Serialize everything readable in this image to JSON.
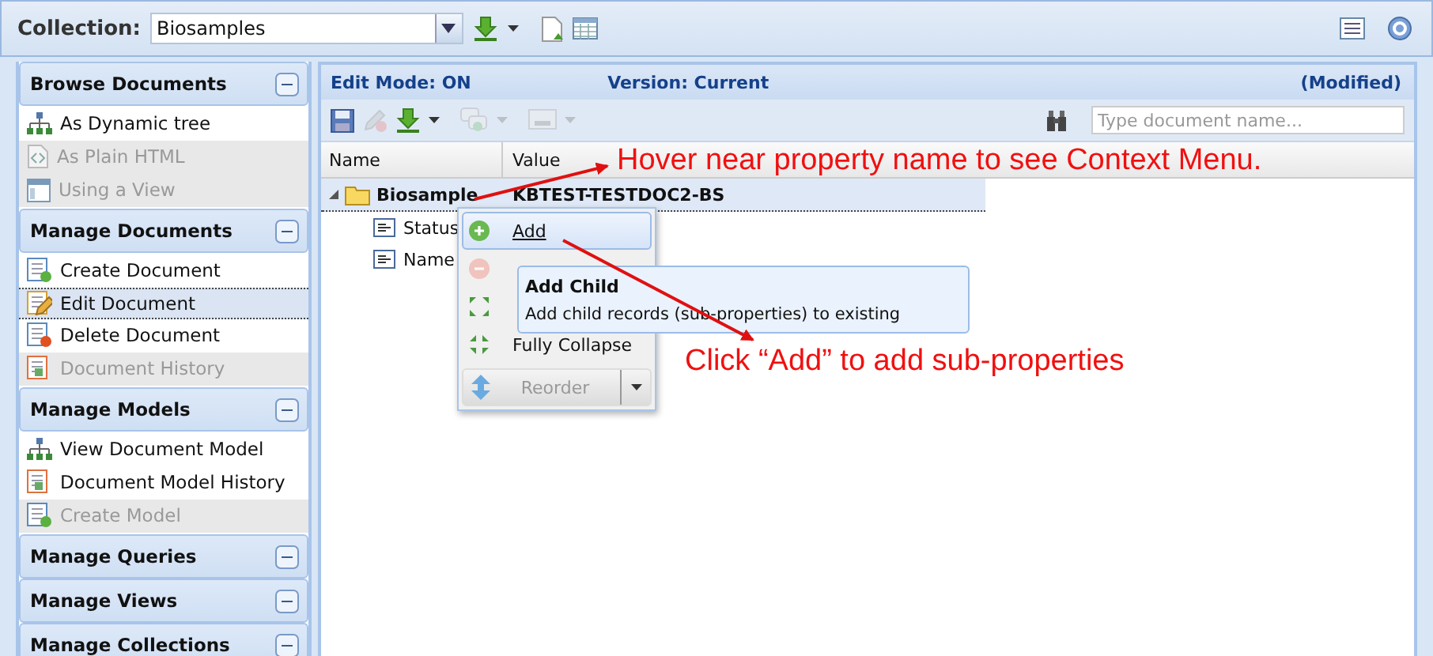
{
  "collection": {
    "label": "Collection:",
    "value": "Biosamples"
  },
  "sidebar": [
    {
      "title": "Browse Documents",
      "items": [
        {
          "label": "As Dynamic tree",
          "kind": "tree",
          "disabled": false,
          "selected": false
        },
        {
          "label": "As Plain HTML",
          "kind": "html",
          "disabled": true,
          "selected": false
        },
        {
          "label": "Using a View",
          "kind": "view",
          "disabled": true,
          "selected": false
        }
      ]
    },
    {
      "title": "Manage Documents",
      "items": [
        {
          "label": "Create Document",
          "kind": "create",
          "disabled": false,
          "selected": false
        },
        {
          "label": "Edit Document",
          "kind": "edit",
          "disabled": false,
          "selected": true
        },
        {
          "label": "Delete Document",
          "kind": "delete",
          "disabled": false,
          "selected": false
        },
        {
          "label": "Document History",
          "kind": "history",
          "disabled": true,
          "selected": false
        }
      ]
    },
    {
      "title": "Manage Models",
      "items": [
        {
          "label": "View Document Model",
          "kind": "tree",
          "disabled": false,
          "selected": false
        },
        {
          "label": "Document Model History",
          "kind": "history",
          "disabled": false,
          "selected": false
        },
        {
          "label": "Create Model",
          "kind": "create",
          "disabled": true,
          "selected": false
        }
      ]
    },
    {
      "title": "Manage Queries"
    },
    {
      "title": "Manage Views"
    },
    {
      "title": "Manage Collections"
    }
  ],
  "panel": {
    "edit_mode": "Edit Mode: ON",
    "version": "Version: Current",
    "status": "(Modified)"
  },
  "search": {
    "placeholder": "Type document name..."
  },
  "columns": [
    "Name",
    "Value"
  ],
  "tree": [
    {
      "name": "Biosample",
      "value": "KBTEST-TESTDOC2-BS",
      "kind": "folder",
      "expanded": true,
      "children": [
        {
          "name": "Status",
          "kind": "field"
        },
        {
          "name": "Name",
          "kind": "field"
        }
      ]
    }
  ],
  "context_menu": {
    "items": [
      {
        "label": "Add",
        "kind": "add",
        "selected": true,
        "disabled": false
      },
      {
        "kind": "remove",
        "selected": false,
        "disabled": true
      },
      {
        "kind": "expand",
        "selected": false,
        "disabled": false
      },
      {
        "label": "Fully Collapse",
        "kind": "collapse",
        "selected": false,
        "disabled": false
      }
    ],
    "reorder": {
      "label": "Reorder",
      "disabled": true
    }
  },
  "tooltip": {
    "title": "Add Child",
    "text": "Add child records (sub-properties) to existing"
  },
  "annotations": [
    {
      "text": "Hover near property name to see Context Menu."
    },
    {
      "text": "Click “Add” to add sub-properties"
    }
  ]
}
